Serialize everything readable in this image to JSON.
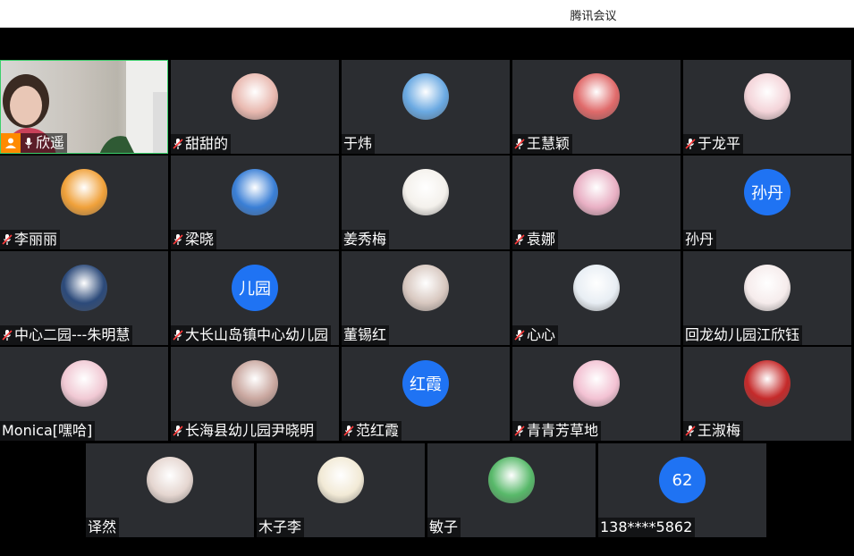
{
  "window": {
    "title": "腾讯会议"
  },
  "participants": [
    {
      "name": "欣遥",
      "muted": false,
      "avatar": "video",
      "host": true
    },
    {
      "name": "甜甜的",
      "muted": true,
      "avatar": "photo",
      "color": "#e9b9b0"
    },
    {
      "name": "于炜",
      "muted": false,
      "avatar": "photo",
      "color": "#6aa9e2"
    },
    {
      "name": "王慧颖",
      "muted": true,
      "avatar": "photo",
      "color": "#e06a6a"
    },
    {
      "name": "于龙平",
      "muted": true,
      "avatar": "photo",
      "color": "#f4d4d9"
    },
    {
      "name": "李丽丽",
      "muted": true,
      "avatar": "photo",
      "color": "#f0a13a"
    },
    {
      "name": "梁晓",
      "muted": true,
      "avatar": "photo",
      "color": "#3a7fd6"
    },
    {
      "name": "姜秀梅",
      "muted": false,
      "avatar": "photo",
      "color": "#f4f1ec"
    },
    {
      "name": "袁娜",
      "muted": true,
      "avatar": "photo",
      "color": "#e9b0c4"
    },
    {
      "name": "孙丹",
      "muted": false,
      "avatar": "text",
      "avatar_text": "孙丹"
    },
    {
      "name": "中心二园---朱明慧",
      "muted": true,
      "avatar": "photo",
      "color": "#2c4a7a"
    },
    {
      "name": "大长山岛镇中心幼儿园",
      "muted": true,
      "avatar": "text",
      "avatar_text": "儿园"
    },
    {
      "name": "董锡红",
      "muted": false,
      "avatar": "photo",
      "color": "#d8c8c0"
    },
    {
      "name": "心心",
      "muted": true,
      "avatar": "photo",
      "color": "#e8eef4"
    },
    {
      "name": "回龙幼儿园江欣钰",
      "muted": false,
      "avatar": "photo",
      "color": "#f6ecec"
    },
    {
      "name": "Monica[嘿哈]",
      "muted": false,
      "avatar": "photo",
      "color": "#f1c9d4"
    },
    {
      "name": "长海县幼儿园尹晓明",
      "muted": true,
      "avatar": "photo",
      "color": "#caa8a0"
    },
    {
      "name": "范红霞",
      "muted": true,
      "avatar": "text",
      "avatar_text": "红霞"
    },
    {
      "name": "青青芳草地",
      "muted": true,
      "avatar": "photo",
      "color": "#f3c2d3"
    },
    {
      "name": "王淑梅",
      "muted": true,
      "avatar": "photo",
      "color": "#c52a2a"
    },
    {
      "name": "译然",
      "muted": false,
      "avatar": "photo",
      "color": "#e5d6d0"
    },
    {
      "name": "木子李",
      "muted": false,
      "avatar": "photo",
      "color": "#f2ead6"
    },
    {
      "name": "敏子",
      "muted": false,
      "avatar": "photo",
      "color": "#58b96a"
    },
    {
      "name": "138****5862",
      "muted": false,
      "avatar": "text",
      "avatar_text": "62"
    }
  ]
}
